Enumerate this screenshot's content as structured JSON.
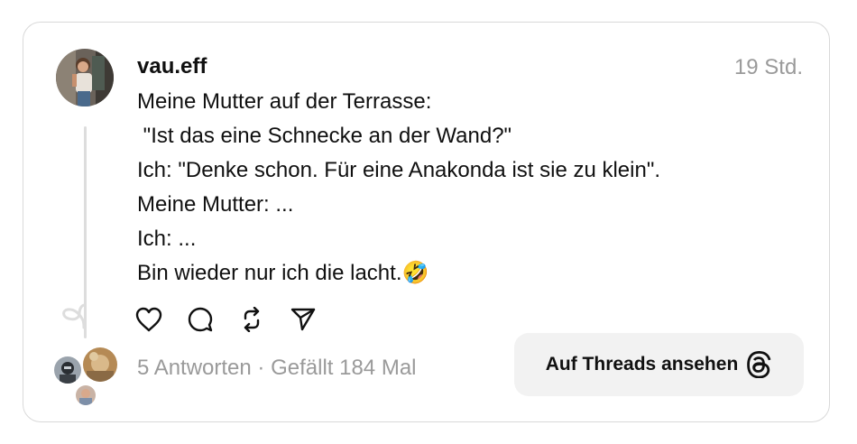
{
  "post": {
    "username": "vau.eff",
    "timestamp": "19 Std.",
    "text": "Meine Mutter auf der Terrasse:\n \"Ist das eine Schnecke an der Wand?\"\nIch: \"Denke schon. Für eine Anakonda ist sie zu klein\".\nMeine Mutter: ...\nIch: ...\nBin wieder nur ich die lacht.🤣"
  },
  "actions": {
    "icons": [
      "heart-icon",
      "comment-icon",
      "repost-icon",
      "share-icon"
    ]
  },
  "stats": {
    "text": "5 Antworten · Gefällt 184 Mal"
  },
  "cta": {
    "label": "Auf Threads ansehen",
    "icon": "threads-logo-icon"
  },
  "colors": {
    "text": "#101010",
    "muted": "#9a9a9a",
    "border": "#d9d9d9",
    "button_bg": "#f2f2f2"
  }
}
